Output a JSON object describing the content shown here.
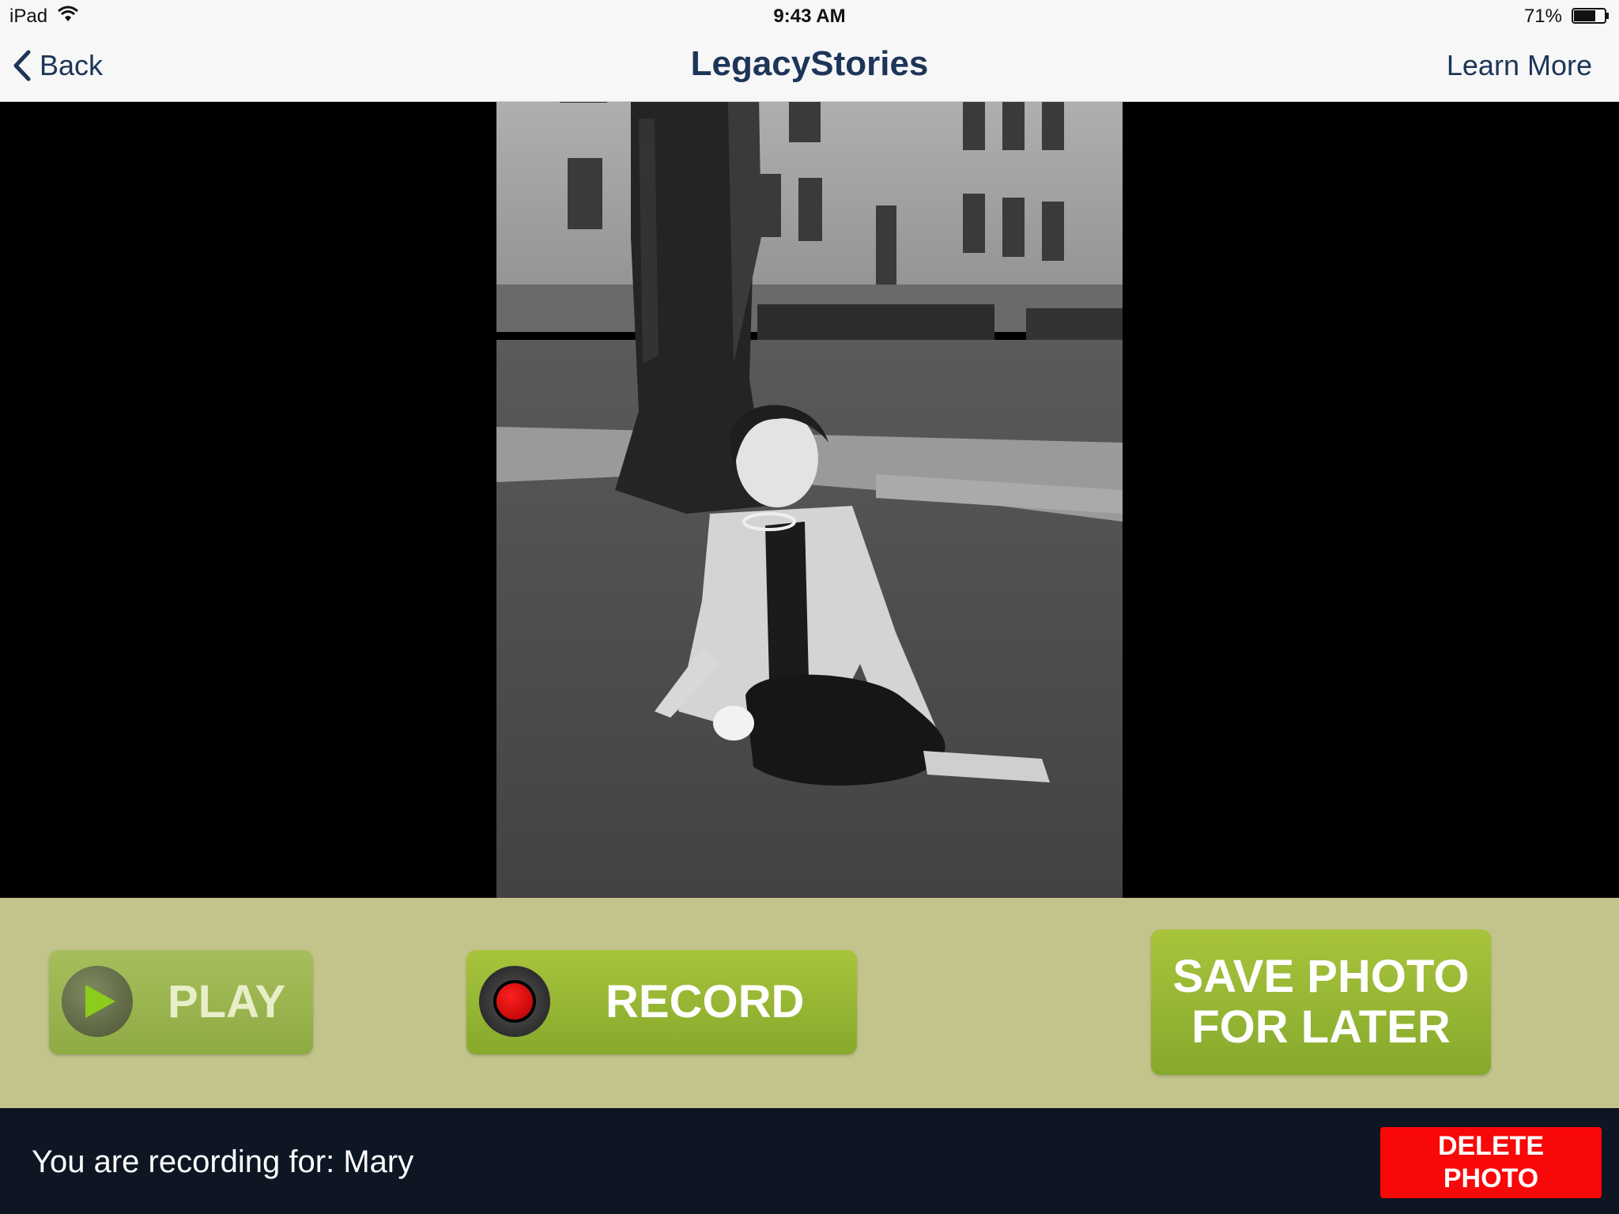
{
  "status_bar": {
    "device": "iPad",
    "time": "9:43 AM",
    "battery": "71%",
    "battery_level": 0.71,
    "icons": [
      "wifi-icon",
      "battery-icon"
    ]
  },
  "nav": {
    "back_label": "Back",
    "title": "LegacyStories",
    "learn_more_label": "Learn More"
  },
  "photo": {
    "description_icon": "black-and-white-photo"
  },
  "controls": {
    "play_label": "PLAY",
    "record_label": "RECORD",
    "save_line1": "SAVE PHOTO",
    "save_line2": "FOR LATER",
    "icons": [
      "play-icon",
      "record-icon"
    ],
    "colors": {
      "band": "#c3c38c",
      "button_green": "#98b734",
      "play_disabled": "#9bb651"
    }
  },
  "footer": {
    "recording_for": "You are recording for: Mary",
    "delete_line1": "DELETE",
    "delete_line2": "PHOTO",
    "colors": {
      "background": "#0e1624",
      "delete": "#f80808"
    }
  }
}
